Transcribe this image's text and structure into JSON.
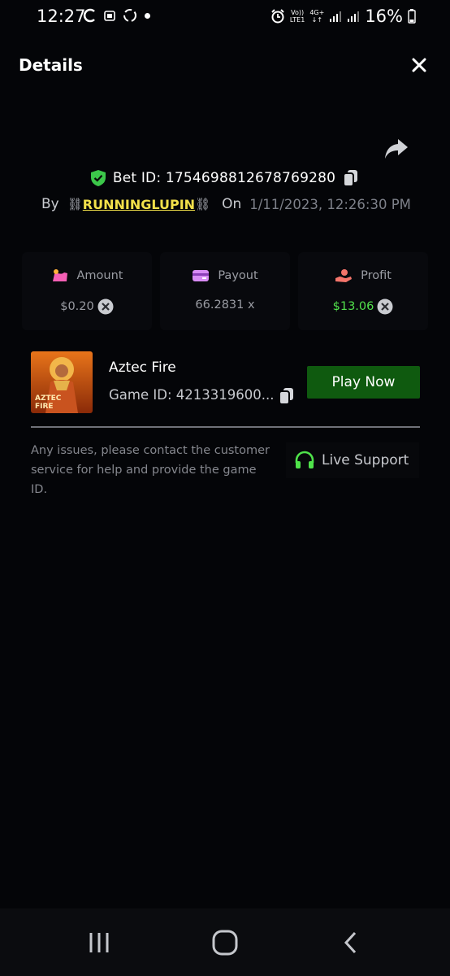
{
  "status_bar": {
    "time": "12:27",
    "network_top": "Vo))",
    "network_bottom": "LTE1",
    "network_type": "4G+",
    "battery": "16%"
  },
  "header": {
    "title": "Details"
  },
  "bet": {
    "id_label": "Bet ID: 1754698812678769280",
    "by_label": "By",
    "chain_left": "⛓",
    "username": "RUNNINGLUPIN",
    "chain_right": "⛓",
    "on_label": "On",
    "date": "1/11/2023, 12:26:30 PM"
  },
  "stats": {
    "amount": {
      "label": "Amount",
      "value": "$0.20"
    },
    "payout": {
      "label": "Payout",
      "value": "66.2831 x"
    },
    "profit": {
      "label": "Profit",
      "value": "$13.06"
    }
  },
  "game": {
    "name": "Aztec Fire",
    "id_label": "Game ID: 4213319600...",
    "thumb_line1": "AZTEC",
    "thumb_line2": "FIRE",
    "play_label": "Play Now"
  },
  "support": {
    "help_text": "Any issues, please contact the customer service for help and provide the game ID.",
    "button_label": "Live Support"
  },
  "colors": {
    "background": "#040508",
    "accent_green": "#52e24c",
    "play_button": "#0f5a0f",
    "username": "#f2e04a"
  },
  "icons": {
    "close": "close-icon",
    "share": "share-icon",
    "shield": "shield-check-icon",
    "copy": "copy-icon",
    "amount": "amount-icon",
    "payout": "card-icon",
    "profit": "hand-coin-icon",
    "coin": "coin-x-icon",
    "headset": "headset-icon",
    "recents": "recents-icon",
    "home": "home-icon",
    "back": "back-icon"
  }
}
